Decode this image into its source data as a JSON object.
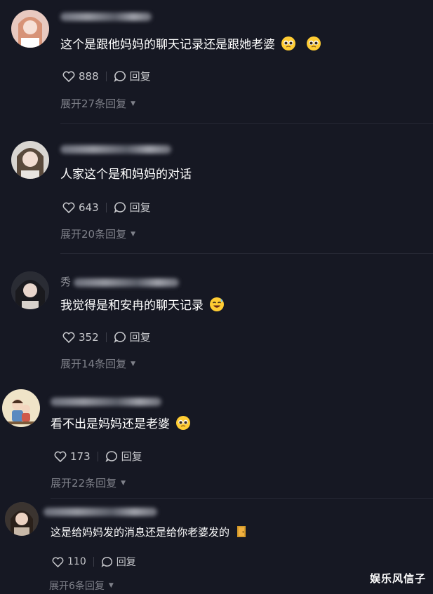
{
  "comments": [
    {
      "name_visible": "",
      "text": "这个是跟他妈妈的聊天记录还是跟她老婆",
      "emoji": [
        "pleading-face",
        "pleading-face"
      ],
      "likes": "888",
      "reply_label": "回复",
      "expand_label": "展开27条回复"
    },
    {
      "name_visible": "",
      "text": "人家这个是和妈妈的对话",
      "emoji": [],
      "likes": "643",
      "reply_label": "回复",
      "expand_label": "展开20条回复"
    },
    {
      "name_visible": "秀",
      "text": "我觉得是和安冉的聊天记录",
      "emoji": [
        "grinning-sweat-face"
      ],
      "likes": "352",
      "reply_label": "回复",
      "expand_label": "展开14条回复"
    },
    {
      "name_visible": "",
      "text": "看不出是妈妈还是老婆",
      "emoji": [
        "pleading-face"
      ],
      "likes": "173",
      "reply_label": "回复",
      "expand_label": "展开22条回复"
    },
    {
      "name_visible": "",
      "text": "这是给妈妈发的消息还是给你老婆发的",
      "emoji": [
        "door-icon"
      ],
      "likes": "110",
      "reply_label": "回复",
      "expand_label": "展开6条回复"
    }
  ],
  "watermark": "娱乐风信子",
  "colors": {
    "background": "#161823",
    "text": "#ffffff",
    "secondary": "#7f818a",
    "emoji_yellow": "#ffcc33"
  }
}
